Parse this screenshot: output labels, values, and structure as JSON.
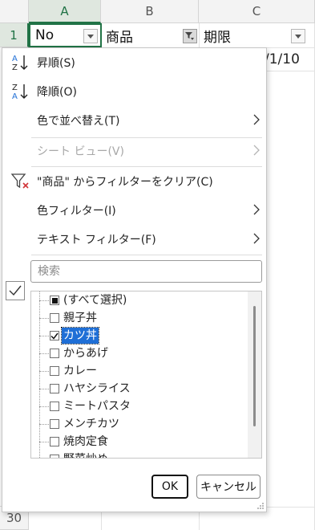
{
  "sheet": {
    "columns": [
      "A",
      "B",
      "C"
    ],
    "rows": [
      "1",
      "30"
    ],
    "header_cells": [
      "No",
      "商品",
      "期限"
    ],
    "partial_cell_c2": "/1/10"
  },
  "menu": {
    "sort_asc": "昇順(S)",
    "sort_desc": "降順(O)",
    "sort_by_color": "色で並べ替え(T)",
    "sheet_view": "シート ビュー(V)",
    "clear_filter": "\"商品\" からフィルターをクリア(C)",
    "color_filter": "色フィルター(I)",
    "text_filter": "テキスト フィルター(F)"
  },
  "search": {
    "placeholder": "検索"
  },
  "list": {
    "items": [
      {
        "label": "(すべて選択)",
        "state": "partial"
      },
      {
        "label": "親子丼",
        "state": "unchecked"
      },
      {
        "label": "カツ丼",
        "state": "checked",
        "selected": true
      },
      {
        "label": "からあげ",
        "state": "unchecked"
      },
      {
        "label": "カレー",
        "state": "unchecked"
      },
      {
        "label": "ハヤシライス",
        "state": "unchecked"
      },
      {
        "label": "ミートパスタ",
        "state": "unchecked"
      },
      {
        "label": "メンチカツ",
        "state": "unchecked"
      },
      {
        "label": "焼肉定食",
        "state": "unchecked"
      },
      {
        "label": "野菜炒め",
        "state": "unchecked"
      }
    ]
  },
  "buttons": {
    "ok": "OK",
    "cancel": "キャンセル"
  },
  "colors": {
    "excel_green": "#217346",
    "selection_blue": "#1f6fd6",
    "clear_filter_red": "#d13438"
  }
}
